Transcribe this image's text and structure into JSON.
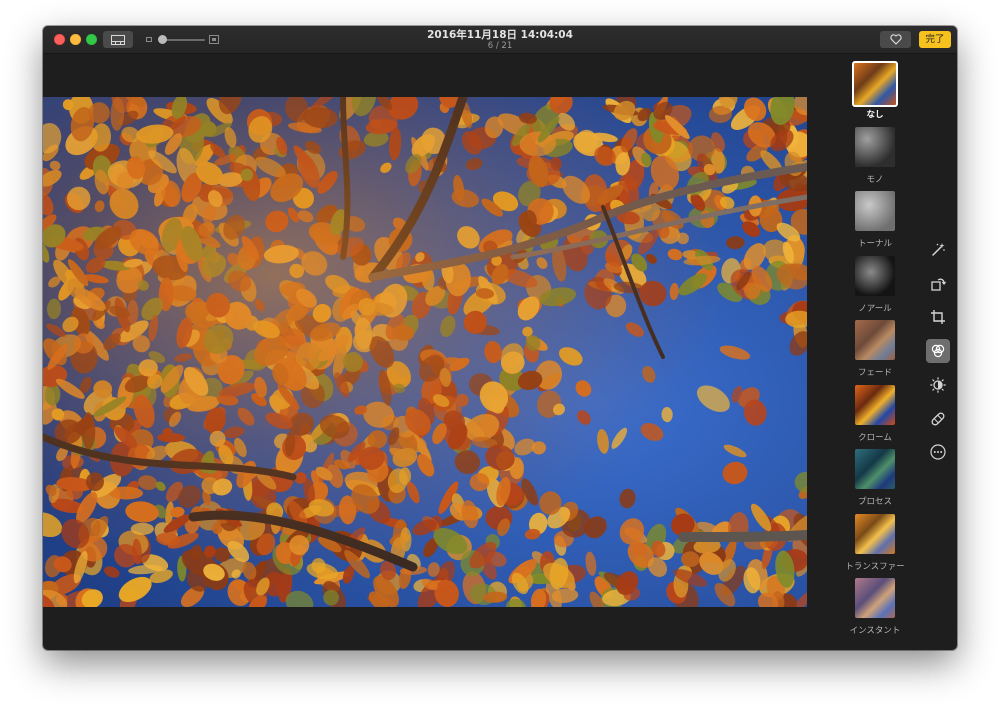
{
  "window": {
    "title": "2016年11月18日 14:04:04",
    "counter": "6 / 21"
  },
  "toolbar": {
    "done_label": "完了",
    "view_icon": "filmstrip-icon",
    "favorite_icon": "heart-icon"
  },
  "filters": [
    {
      "label": "なし",
      "selected": true
    },
    {
      "label": "モノ"
    },
    {
      "label": "トーナル"
    },
    {
      "label": "ノアール"
    },
    {
      "label": "フェード"
    },
    {
      "label": "クローム"
    },
    {
      "label": "プロセス"
    },
    {
      "label": "トランスファー"
    },
    {
      "label": "インスタント"
    }
  ],
  "tools": [
    {
      "name": "auto-enhance-icon"
    },
    {
      "name": "rotate-icon"
    },
    {
      "name": "crop-icon"
    },
    {
      "name": "filters-icon",
      "active": true
    },
    {
      "name": "adjust-icon"
    },
    {
      "name": "retouch-icon"
    },
    {
      "name": "more-icon"
    }
  ],
  "colors": {
    "accent": "#f7c21d",
    "window_bg": "#1e1e1e",
    "sky": "#2f5fb8",
    "leaf_orange": "#d9711e",
    "leaf_yellow": "#e9a826"
  }
}
